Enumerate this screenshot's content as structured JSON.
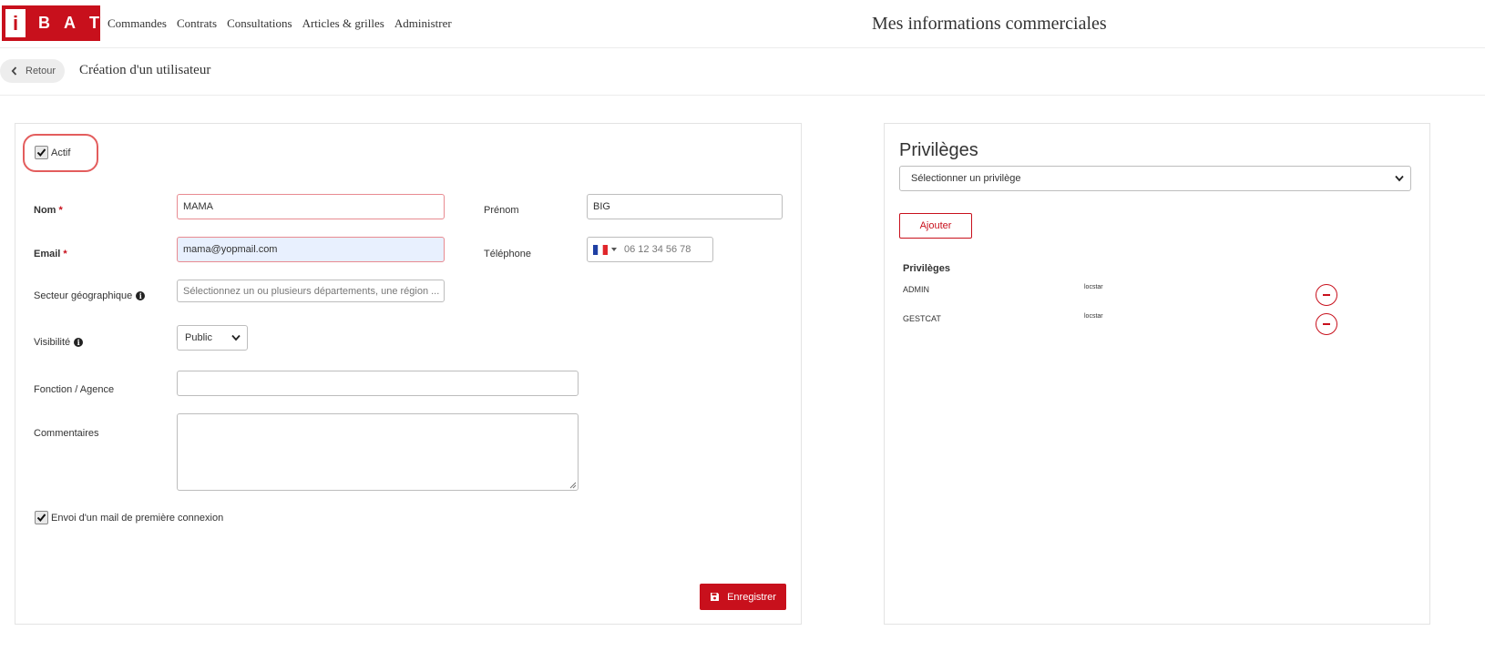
{
  "brand": {
    "logo_box": "i",
    "logo_letters": [
      "B",
      "A",
      "T"
    ],
    "color": "#c8101c"
  },
  "nav": [
    "Commandes",
    "Contrats",
    "Consultations",
    "Articles & grilles",
    "Administrer"
  ],
  "header": {
    "title": "Mes informations commerciales"
  },
  "subheader": {
    "back_label": "Retour",
    "title": "Création d'un utilisateur"
  },
  "form": {
    "actif_label": "Actif",
    "actif_checked": true,
    "nom_label": "Nom",
    "nom_value": "MAMA",
    "prenom_label": "Prénom",
    "prenom_value": "BIG",
    "email_label": "Email",
    "email_value": "mama@yopmail.com",
    "telephone_label": "Téléphone",
    "telephone_placeholder": "06 12 34 56 78",
    "secteur_label": "Secteur géographique",
    "secteur_placeholder": "Sélectionnez un ou plusieurs départements, une région ...",
    "visibilite_label": "Visibilité",
    "visibilite_value": "Public",
    "fonction_label": "Fonction / Agence",
    "fonction_value": "",
    "commentaires_label": "Commentaires",
    "commentaires_value": "",
    "mail_label": "Envoi d'un mail de première connexion",
    "mail_checked": true,
    "required_mark": "*",
    "info_mark": "i",
    "save_label": "Enregistrer"
  },
  "privileges": {
    "title": "Privilèges",
    "select_placeholder": "Sélectionner un privilège",
    "add_label": "Ajouter",
    "list_header": "Privilèges",
    "items": [
      {
        "name": "ADMIN",
        "source": "locstar"
      },
      {
        "name": "GESTCAT",
        "source": "locstar"
      }
    ]
  }
}
